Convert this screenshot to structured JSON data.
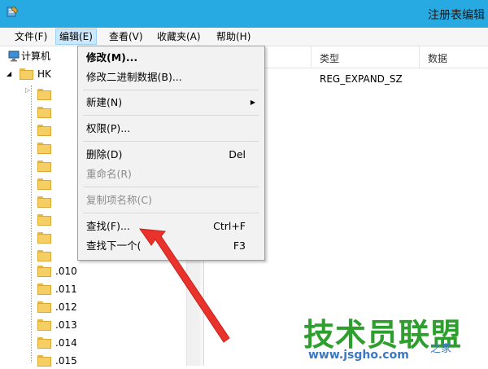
{
  "window": {
    "title": "注册表编辑"
  },
  "menubar": {
    "items": [
      {
        "label": "文件(F)"
      },
      {
        "label": "编辑(E)"
      },
      {
        "label": "查看(V)"
      },
      {
        "label": "收藏夹(A)"
      },
      {
        "label": "帮助(H)"
      }
    ]
  },
  "tree": {
    "root": "计算机",
    "hk": "HK",
    "items": [
      ".010",
      ".011",
      ".012",
      ".013",
      ".014",
      ".015"
    ]
  },
  "table": {
    "columns": [
      "类型",
      "数据"
    ],
    "rows": [
      {
        "type": "REG_EXPAND_SZ"
      }
    ]
  },
  "context_menu": {
    "items": [
      {
        "label": "修改(M)...",
        "shortcut": "",
        "bold": true
      },
      {
        "label": "修改二进制数据(B)...",
        "shortcut": ""
      },
      {
        "label": "新建(N)",
        "shortcut": "",
        "submenu": true
      },
      {
        "label": "权限(P)...",
        "shortcut": ""
      },
      {
        "label": "删除(D)",
        "shortcut": "Del"
      },
      {
        "label": "重命名(R)",
        "shortcut": "",
        "disabled": true
      },
      {
        "label": "复制项名称(C)",
        "shortcut": "",
        "disabled": true
      },
      {
        "label": "查找(F)...",
        "shortcut": "Ctrl+F"
      },
      {
        "label": "查找下一个(",
        "shortcut": "F3"
      }
    ]
  },
  "watermark": {
    "brand": "技术员联盟",
    "url": "www.jsgho.com",
    "home": "之家"
  },
  "annotation": {
    "arrow_color": "#e8322b"
  }
}
